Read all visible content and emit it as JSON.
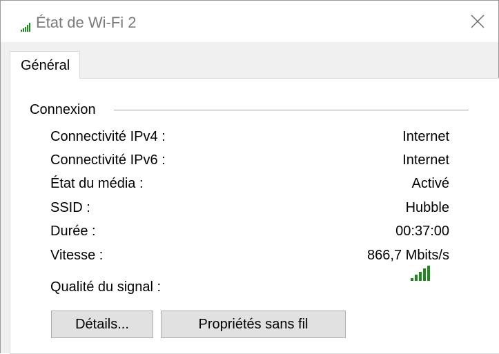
{
  "window": {
    "title": "État de Wi-Fi 2",
    "title_icon": "wifi-signal-icon",
    "close_icon": "close-icon"
  },
  "tabs": [
    {
      "label": "Général",
      "active": true
    }
  ],
  "connection": {
    "group_title": "Connexion",
    "rows": [
      {
        "label": "Connectivité IPv4 :",
        "value": "Internet"
      },
      {
        "label": "Connectivité IPv6 :",
        "value": "Internet"
      },
      {
        "label": "État du média :",
        "value": "Activé"
      },
      {
        "label": "SSID :",
        "value": "Hubble"
      },
      {
        "label": "Durée :",
        "value": "00:37:00"
      },
      {
        "label": "Vitesse :",
        "value": "866,7 Mbits/s"
      }
    ],
    "signal_label": "Qualité du signal :",
    "signal_bars_active": 5,
    "signal_bars_total": 5,
    "signal_color": "#1e8a1e"
  },
  "buttons": {
    "details": "Détails...",
    "wireless_properties": "Propriétés sans fil"
  }
}
